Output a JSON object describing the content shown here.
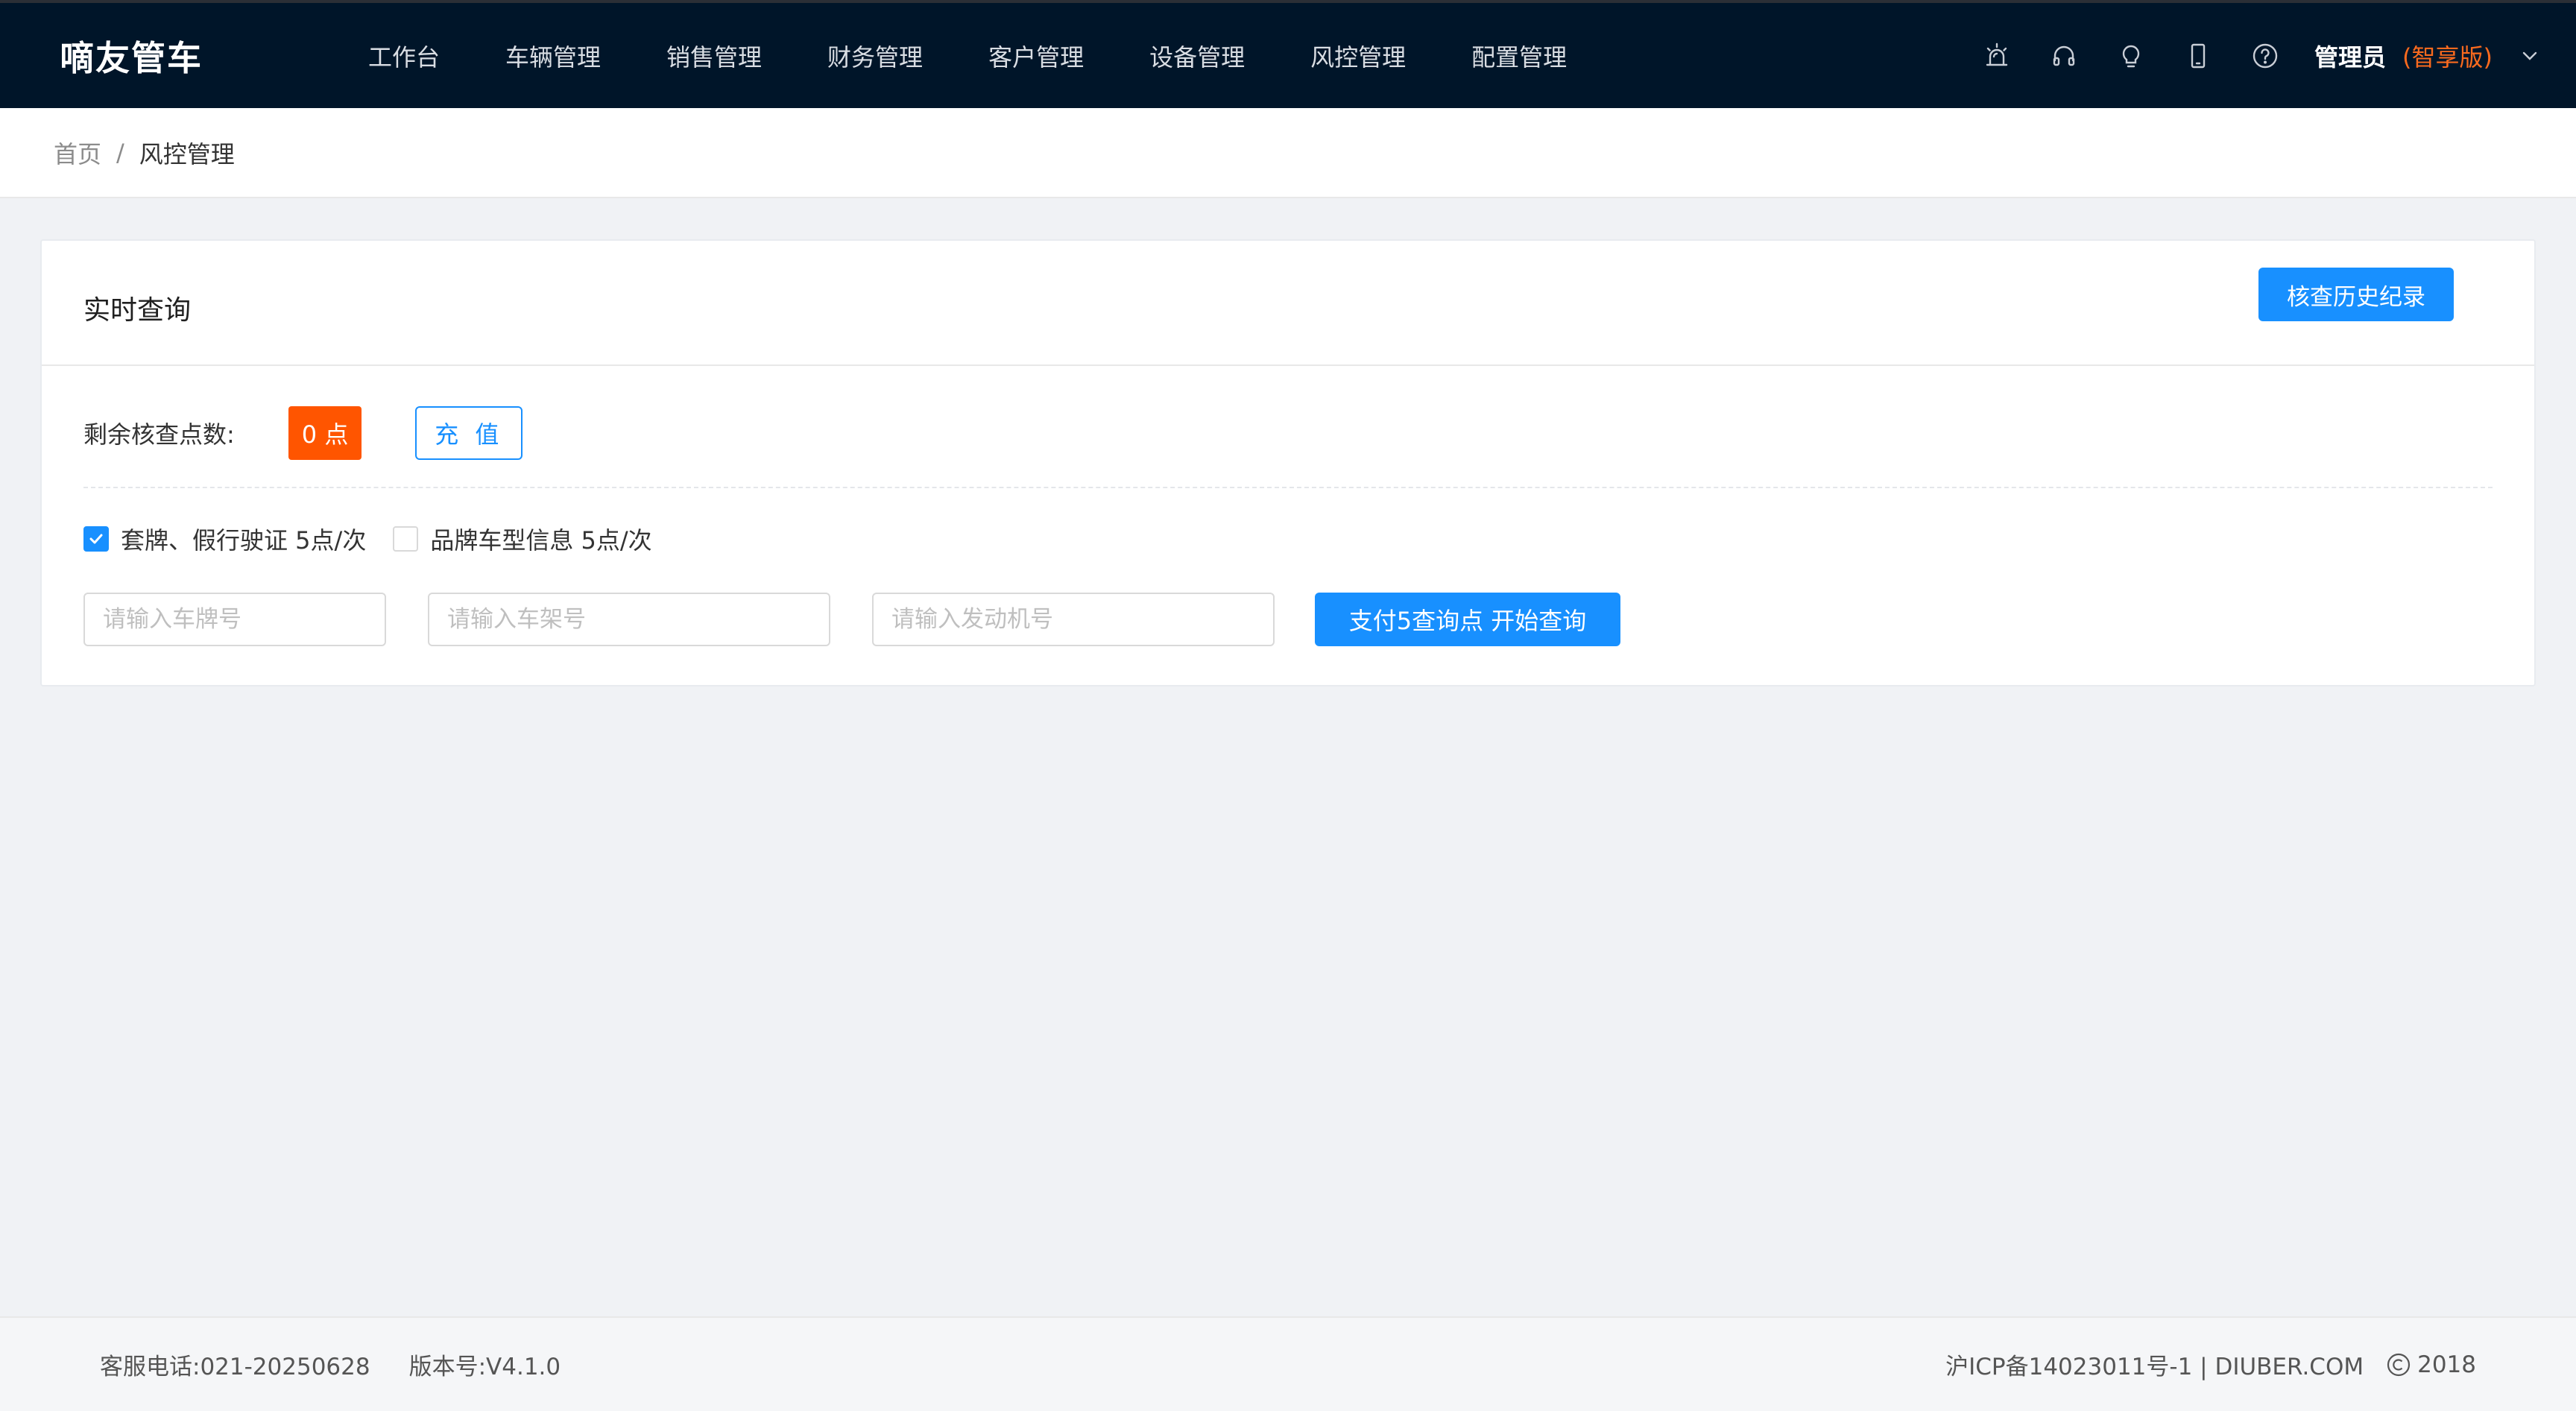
{
  "app": {
    "logo": "嘀友管车"
  },
  "nav": {
    "items": [
      {
        "label": "工作台"
      },
      {
        "label": "车辆管理"
      },
      {
        "label": "销售管理"
      },
      {
        "label": "财务管理"
      },
      {
        "label": "客户管理"
      },
      {
        "label": "设备管理"
      },
      {
        "label": "风控管理"
      },
      {
        "label": "配置管理"
      }
    ]
  },
  "toolbar": {
    "icons": [
      "alarm-icon",
      "headset-icon",
      "lightbulb-icon",
      "mobile-icon",
      "help-icon"
    ]
  },
  "user": {
    "name": "管理员",
    "edition": "(智享版)"
  },
  "breadcrumb": {
    "home": "首页",
    "separator": "/",
    "current": "风控管理"
  },
  "card": {
    "title": "实时查询",
    "history_button": "核查历史纪录",
    "points_label": "剩余核查点数:",
    "points_value": "0 点",
    "recharge_button": "充 值",
    "options": [
      {
        "label": "套牌、假行驶证 5点/次",
        "checked": true
      },
      {
        "label": "品牌车型信息 5点/次",
        "checked": false
      }
    ],
    "inputs": {
      "plate_placeholder": "请输入车牌号",
      "vin_placeholder": "请输入车架号",
      "engine_placeholder": "请输入发动机号"
    },
    "query_button": "支付5查询点 开始查询"
  },
  "footer": {
    "phone": "客服电话:021-20250628",
    "version": "版本号:V4.1.0",
    "icp": "沪ICP备14023011号-1 | DIUBER.COM",
    "copyright_year": "2018"
  },
  "colors": {
    "topbar": "#001529",
    "primary": "#1890ff",
    "accent_orange": "#ff5500",
    "edition_orange": "#fa6a1e",
    "page_bg": "#f0f2f5"
  }
}
